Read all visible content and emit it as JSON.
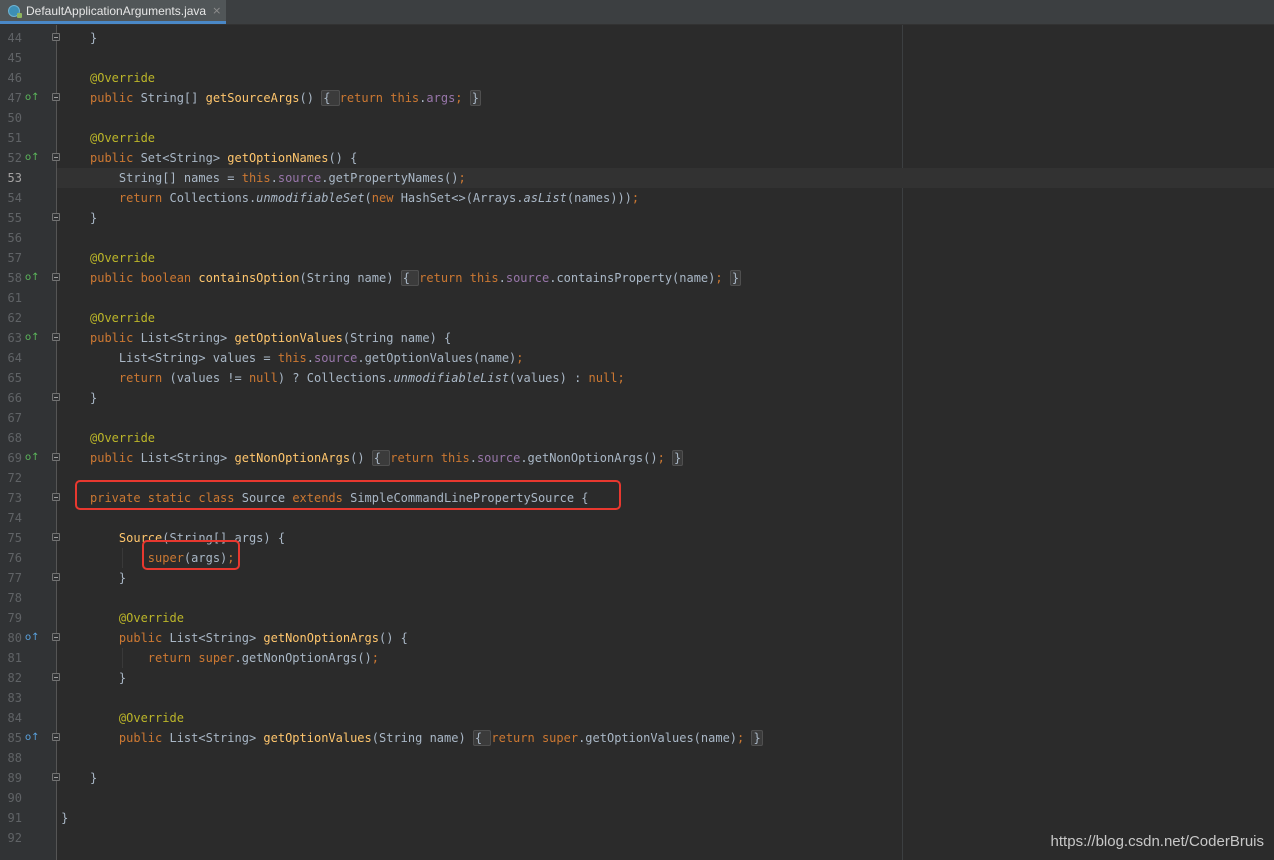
{
  "tab": {
    "title": "DefaultApplicationArguments.java",
    "close_glyph": "×",
    "icon": "java-class-icon"
  },
  "editor": {
    "current_line": "53",
    "lines": [
      {
        "n": "44",
        "indent": 1,
        "marker": "",
        "fold": true,
        "toks": [
          [
            "}",
            ""
          ]
        ]
      },
      {
        "n": "45",
        "indent": 0,
        "marker": "",
        "fold": false,
        "toks": []
      },
      {
        "n": "46",
        "indent": 1,
        "marker": "",
        "fold": false,
        "toks": [
          [
            "@Override",
            "ann"
          ]
        ]
      },
      {
        "n": "47",
        "indent": 1,
        "marker": "override",
        "fold": true,
        "toks": [
          [
            "public ",
            "kw"
          ],
          [
            "String[] ",
            ""
          ],
          [
            "getSourceArgs",
            "fn"
          ],
          [
            "() ",
            ""
          ],
          [
            "{ ",
            "box"
          ],
          [
            "return ",
            "kw"
          ],
          [
            "this",
            "kw"
          ],
          [
            ".",
            ""
          ],
          [
            "args",
            "field"
          ],
          [
            "; ",
            "kw"
          ],
          [
            "}",
            "box"
          ]
        ]
      },
      {
        "n": "50",
        "indent": 0,
        "marker": "",
        "fold": false,
        "toks": []
      },
      {
        "n": "51",
        "indent": 1,
        "marker": "",
        "fold": false,
        "toks": [
          [
            "@Override",
            "ann"
          ]
        ]
      },
      {
        "n": "52",
        "indent": 1,
        "marker": "override",
        "fold": true,
        "toks": [
          [
            "public ",
            "kw"
          ],
          [
            "Set<String> ",
            ""
          ],
          [
            "getOptionNames",
            "fn"
          ],
          [
            "() {",
            ""
          ]
        ]
      },
      {
        "n": "53",
        "indent": 2,
        "marker": "",
        "fold": false,
        "toks": [
          [
            "String[] names = ",
            ""
          ],
          [
            "this",
            "kw"
          ],
          [
            ".",
            ""
          ],
          [
            "source",
            "field"
          ],
          [
            ".getPropertyNames",
            ""
          ],
          [
            "()",
            ""
          ],
          [
            ";",
            "kw"
          ]
        ]
      },
      {
        "n": "54",
        "indent": 2,
        "marker": "",
        "fold": false,
        "toks": [
          [
            "return ",
            "kw"
          ],
          [
            "Collections.",
            ""
          ],
          [
            "unmodifiableSet",
            "static"
          ],
          [
            "(",
            ""
          ],
          [
            "new ",
            "kw"
          ],
          [
            "HashSet<>(Arrays.",
            ""
          ],
          [
            "asList",
            "static"
          ],
          [
            "(names)))",
            ""
          ],
          [
            ";",
            "kw"
          ]
        ]
      },
      {
        "n": "55",
        "indent": 1,
        "marker": "",
        "fold": true,
        "toks": [
          [
            "}",
            ""
          ]
        ]
      },
      {
        "n": "56",
        "indent": 0,
        "marker": "",
        "fold": false,
        "toks": []
      },
      {
        "n": "57",
        "indent": 1,
        "marker": "",
        "fold": false,
        "toks": [
          [
            "@Override",
            "ann"
          ]
        ]
      },
      {
        "n": "58",
        "indent": 1,
        "marker": "override",
        "fold": true,
        "toks": [
          [
            "public ",
            "kw"
          ],
          [
            "boolean ",
            "kw"
          ],
          [
            "containsOption",
            "fn"
          ],
          [
            "(String name) ",
            ""
          ],
          [
            "{ ",
            "box"
          ],
          [
            "return ",
            "kw"
          ],
          [
            "this",
            "kw"
          ],
          [
            ".",
            ""
          ],
          [
            "source",
            "field"
          ],
          [
            ".containsProperty(name)",
            ""
          ],
          [
            "; ",
            "kw"
          ],
          [
            "}",
            "box"
          ]
        ]
      },
      {
        "n": "61",
        "indent": 0,
        "marker": "",
        "fold": false,
        "toks": []
      },
      {
        "n": "62",
        "indent": 1,
        "marker": "",
        "fold": false,
        "toks": [
          [
            "@Override",
            "ann"
          ]
        ]
      },
      {
        "n": "63",
        "indent": 1,
        "marker": "override",
        "fold": true,
        "toks": [
          [
            "public ",
            "kw"
          ],
          [
            "List<String> ",
            ""
          ],
          [
            "getOptionValues",
            "fn"
          ],
          [
            "(String name) {",
            ""
          ]
        ]
      },
      {
        "n": "64",
        "indent": 2,
        "marker": "",
        "fold": false,
        "toks": [
          [
            "List<String> values = ",
            ""
          ],
          [
            "this",
            "kw"
          ],
          [
            ".",
            ""
          ],
          [
            "source",
            "field"
          ],
          [
            ".getOptionValues(name)",
            ""
          ],
          [
            ";",
            "kw"
          ]
        ]
      },
      {
        "n": "65",
        "indent": 2,
        "marker": "",
        "fold": false,
        "toks": [
          [
            "return ",
            "kw"
          ],
          [
            "(values != ",
            ""
          ],
          [
            "null",
            "kw"
          ],
          [
            ") ? Collections.",
            ""
          ],
          [
            "unmodifiableList",
            "static"
          ],
          [
            "(values) : ",
            ""
          ],
          [
            "null",
            "kw"
          ],
          [
            ";",
            "kw"
          ]
        ]
      },
      {
        "n": "66",
        "indent": 1,
        "marker": "",
        "fold": true,
        "toks": [
          [
            "}",
            ""
          ]
        ]
      },
      {
        "n": "67",
        "indent": 0,
        "marker": "",
        "fold": false,
        "toks": []
      },
      {
        "n": "68",
        "indent": 1,
        "marker": "",
        "fold": false,
        "toks": [
          [
            "@Override",
            "ann"
          ]
        ]
      },
      {
        "n": "69",
        "indent": 1,
        "marker": "override",
        "fold": true,
        "toks": [
          [
            "public ",
            "kw"
          ],
          [
            "List<String> ",
            ""
          ],
          [
            "getNonOptionArgs",
            "fn"
          ],
          [
            "() ",
            ""
          ],
          [
            "{ ",
            "box"
          ],
          [
            "return ",
            "kw"
          ],
          [
            "this",
            "kw"
          ],
          [
            ".",
            ""
          ],
          [
            "source",
            "field"
          ],
          [
            ".getNonOptionArgs()",
            ""
          ],
          [
            "; ",
            "kw"
          ],
          [
            "}",
            "box"
          ]
        ]
      },
      {
        "n": "72",
        "indent": 0,
        "marker": "",
        "fold": false,
        "toks": []
      },
      {
        "n": "73",
        "indent": 1,
        "marker": "",
        "fold": true,
        "toks": [
          [
            "private ",
            "kw"
          ],
          [
            "static ",
            "kw"
          ],
          [
            "class ",
            "kw"
          ],
          [
            "Source ",
            ""
          ],
          [
            "extends ",
            "kw"
          ],
          [
            "SimpleCommandLinePropertySource {",
            ""
          ]
        ]
      },
      {
        "n": "74",
        "indent": 0,
        "marker": "",
        "fold": false,
        "toks": []
      },
      {
        "n": "75",
        "indent": 2,
        "marker": "",
        "fold": true,
        "toks": [
          [
            "Source",
            "fn"
          ],
          [
            "(String[] args) {",
            ""
          ]
        ]
      },
      {
        "n": "76",
        "indent": 3,
        "marker": "",
        "fold": false,
        "toks": [
          [
            "super",
            "kw"
          ],
          [
            "(args)",
            ""
          ],
          [
            ";",
            "kw"
          ]
        ]
      },
      {
        "n": "77",
        "indent": 2,
        "marker": "",
        "fold": true,
        "toks": [
          [
            "}",
            ""
          ]
        ]
      },
      {
        "n": "78",
        "indent": 0,
        "marker": "",
        "fold": false,
        "toks": []
      },
      {
        "n": "79",
        "indent": 2,
        "marker": "",
        "fold": false,
        "toks": [
          [
            "@Override",
            "ann"
          ]
        ]
      },
      {
        "n": "80",
        "indent": 2,
        "marker": "implement",
        "fold": true,
        "toks": [
          [
            "public ",
            "kw"
          ],
          [
            "List<String> ",
            ""
          ],
          [
            "getNonOptionArgs",
            "fn"
          ],
          [
            "() {",
            ""
          ]
        ]
      },
      {
        "n": "81",
        "indent": 3,
        "marker": "",
        "fold": false,
        "toks": [
          [
            "return ",
            "kw"
          ],
          [
            "super",
            "kw"
          ],
          [
            ".getNonOptionArgs()",
            ""
          ],
          [
            ";",
            "kw"
          ]
        ]
      },
      {
        "n": "82",
        "indent": 2,
        "marker": "",
        "fold": true,
        "toks": [
          [
            "}",
            ""
          ]
        ]
      },
      {
        "n": "83",
        "indent": 0,
        "marker": "",
        "fold": false,
        "toks": []
      },
      {
        "n": "84",
        "indent": 2,
        "marker": "",
        "fold": false,
        "toks": [
          [
            "@Override",
            "ann"
          ]
        ]
      },
      {
        "n": "85",
        "indent": 2,
        "marker": "implement",
        "fold": true,
        "toks": [
          [
            "public ",
            "kw"
          ],
          [
            "List<String> ",
            ""
          ],
          [
            "getOptionValues",
            "fn"
          ],
          [
            "(String name) ",
            ""
          ],
          [
            "{ ",
            "box"
          ],
          [
            "return ",
            "kw"
          ],
          [
            "super",
            "kw"
          ],
          [
            ".getOptionValues(name)",
            ""
          ],
          [
            "; ",
            "kw"
          ],
          [
            "}",
            "box"
          ]
        ]
      },
      {
        "n": "88",
        "indent": 0,
        "marker": "",
        "fold": false,
        "toks": []
      },
      {
        "n": "89",
        "indent": 1,
        "marker": "",
        "fold": true,
        "toks": [
          [
            "}",
            ""
          ]
        ]
      },
      {
        "n": "90",
        "indent": 0,
        "marker": "",
        "fold": false,
        "toks": []
      },
      {
        "n": "91",
        "indent": 0,
        "marker": "",
        "fold": false,
        "toks": [
          [
            "}",
            ""
          ]
        ]
      },
      {
        "n": "92",
        "indent": 0,
        "marker": "",
        "fold": false,
        "toks": []
      }
    ]
  },
  "markers": {
    "override_glyph": "o↑",
    "override_icon": "override-method-icon",
    "implement_glyph": "o↑",
    "implement_icon": "implement-method-icon"
  },
  "highlights": [
    {
      "line": "73",
      "label": "class-declaration"
    },
    {
      "line": "76",
      "label": "super-call"
    }
  ],
  "colors": {
    "background": "#2b2b2b",
    "keyword": "#cc7832",
    "annotation": "#bbb529",
    "field": "#9876aa",
    "method": "#ffc66d",
    "text": "#a9b7c6",
    "highlight_box": "#e8382f"
  },
  "watermark": "https://blog.csdn.net/CoderBruis"
}
